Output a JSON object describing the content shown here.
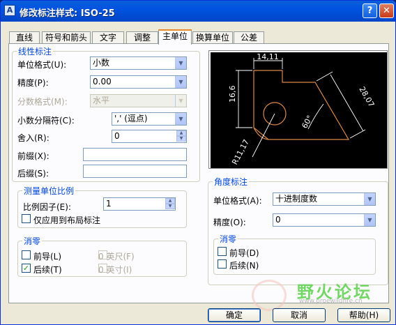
{
  "window": {
    "title": "修改标注样式: ISO-25",
    "icon": "autocad-dim-icon"
  },
  "titlebar_buttons": {
    "help": "?",
    "close": "✕"
  },
  "tabs": [
    "直线",
    "符号和箭头",
    "文字",
    "调整",
    "主单位",
    "换算单位",
    "公差"
  ],
  "active_tab": "主单位",
  "linear": {
    "legend": "线性标注",
    "unit_format_label": "单位格式(U):",
    "unit_format_value": "小数",
    "precision_label": "精度(P):",
    "precision_value": "0.00",
    "fraction_label": "分数格式(M):",
    "fraction_value": "水平",
    "decimal_sep_label": "小数分隔符(C):",
    "decimal_sep_value": "',' (逗点)",
    "roundoff_label": "舍入(R):",
    "roundoff_value": "0",
    "prefix_label": "前缀(X):",
    "prefix_value": "",
    "suffix_label": "后缀(S):",
    "suffix_value": ""
  },
  "scale": {
    "legend": "测量单位比例",
    "factor_label": "比例因子(E):",
    "factor_value": "1",
    "layout_only_label": "仅应用到布局标注",
    "layout_only_checked": false
  },
  "zero_linear": {
    "legend": "消零",
    "leading_label": "前导(L)",
    "leading_checked": false,
    "trailing_label": "后续(T)",
    "trailing_checked": true,
    "feet_label": "0 英尺(F)",
    "inches_label": "0 英寸(I)"
  },
  "angular": {
    "legend": "角度标注",
    "unit_format_label": "单位格式(A):",
    "unit_format_value": "十进制度数",
    "precision_label": "精度(O):",
    "precision_value": "0"
  },
  "zero_angular": {
    "legend": "消零",
    "leading_label": "前导(D)",
    "leading_checked": false,
    "trailing_label": "后续(N)",
    "trailing_checked": false
  },
  "preview": {
    "dim_top": "14,11",
    "dim_left": "16,6",
    "dim_right": "28,07",
    "dim_angle": "60°",
    "dim_radius": "R11,17",
    "colors": {
      "bg": "#000000",
      "dim": "#ffffff",
      "geom": "#d98a4a"
    }
  },
  "buttons": {
    "ok": "确定",
    "cancel": "取消",
    "help": "帮助(H)"
  },
  "watermark": {
    "text": "野火论坛",
    "url": "www.proewildfire.cn"
  }
}
